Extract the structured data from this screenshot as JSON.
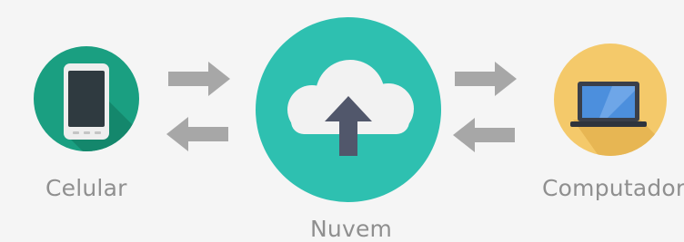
{
  "nodes": {
    "phone": {
      "label": "Celular",
      "color": "#1a9f81",
      "icon": "smartphone-icon"
    },
    "cloud": {
      "label": "Nuvem",
      "color": "#2ec0b0",
      "icon": "cloud-upload-icon"
    },
    "computer": {
      "label": "Computador",
      "color": "#f4c96a",
      "icon": "laptop-icon"
    }
  },
  "edges": [
    {
      "from": "phone",
      "to": "cloud"
    },
    {
      "from": "cloud",
      "to": "phone"
    },
    {
      "from": "cloud",
      "to": "computer"
    },
    {
      "from": "computer",
      "to": "cloud"
    }
  ],
  "arrow_color": "#a7a7a7"
}
